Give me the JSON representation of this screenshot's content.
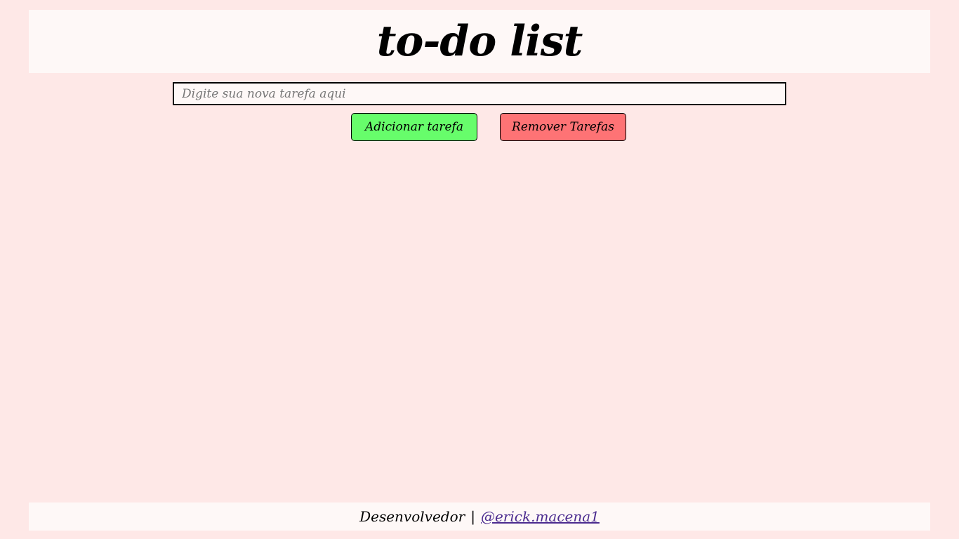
{
  "header": {
    "title": "to-do list"
  },
  "task_input": {
    "placeholder": "Digite sua nova tarefa aqui",
    "value": ""
  },
  "buttons": {
    "add_label": "Adicionar tarefa",
    "remove_label": "Remover Tarefas"
  },
  "task_list": {
    "items": []
  },
  "footer": {
    "label": "Desenvolvedor",
    "separator": "|",
    "link_text": "@erick.macena1"
  },
  "colors": {
    "page_background": "#fee8e7",
    "panel_background": "#fef8f7",
    "add_button": "#67fd6b",
    "remove_button": "#fe7375",
    "link": "#4b2b8f"
  }
}
